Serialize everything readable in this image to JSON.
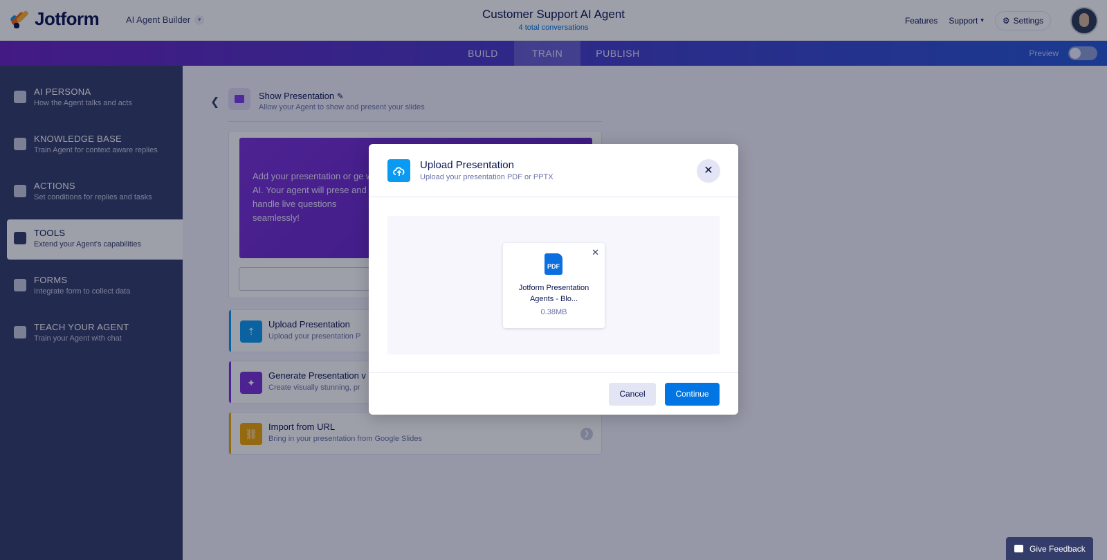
{
  "header": {
    "logo_text": "Jotform",
    "builder_label": "AI Agent Builder",
    "agent_title": "Customer Support AI Agent",
    "agent_subtitle": "4 total conversations",
    "links": {
      "features": "Features",
      "support": "Support",
      "settings": "Settings"
    }
  },
  "tabs": [
    {
      "label": "BUILD",
      "active": false
    },
    {
      "label": "TRAIN",
      "active": true
    },
    {
      "label": "PUBLISH",
      "active": false
    }
  ],
  "preview_label": "Preview",
  "sidebar": {
    "items": [
      {
        "title": "AI PERSONA",
        "subtitle": "How the Agent talks and acts",
        "icon": "id-card-icon"
      },
      {
        "title": "KNOWLEDGE BASE",
        "subtitle": "Train Agent for context aware replies",
        "icon": "knowledge-icon"
      },
      {
        "title": "ACTIONS",
        "subtitle": "Set conditions for replies and tasks",
        "icon": "flag-icon"
      },
      {
        "title": "TOOLS",
        "subtitle": "Extend your Agent's capabilities",
        "icon": "tools-icon",
        "active": true
      },
      {
        "title": "FORMS",
        "subtitle": "Integrate form to collect data",
        "icon": "form-icon"
      },
      {
        "title": "TEACH YOUR AGENT",
        "subtitle": "Train your Agent with chat",
        "icon": "chat-icon"
      }
    ]
  },
  "tool": {
    "title": "Show Presentation",
    "subtitle": "Allow your Agent to show and present your slides",
    "banner_text": "Add your presentation or ge with AI. Your agent will prese and handle live questions seamlessly!",
    "options": [
      {
        "title": "Upload Presentation",
        "subtitle": "Upload your presentation P",
        "color": "#0a9af2"
      },
      {
        "title": "Generate Presentation v",
        "subtitle": "Create visually stunning, pr",
        "color": "#7b2fd8"
      },
      {
        "title": "Import from URL",
        "subtitle": "Bring in your presentation from Google Slides",
        "color": "#f0a500"
      }
    ]
  },
  "modal": {
    "title": "Upload Presentation",
    "subtitle": "Upload your presentation PDF or PPTX",
    "file": {
      "badge": "PDF",
      "name": "Jotform Presentation Agents - Blo...",
      "size": "0.38MB"
    },
    "cancel_label": "Cancel",
    "continue_label": "Continue"
  },
  "feedback_label": "Give Feedback",
  "colors": {
    "primary": "#0075e3",
    "navy": "#0a1551",
    "sidebar": "#343c6a",
    "purple": "#6a22c2"
  }
}
